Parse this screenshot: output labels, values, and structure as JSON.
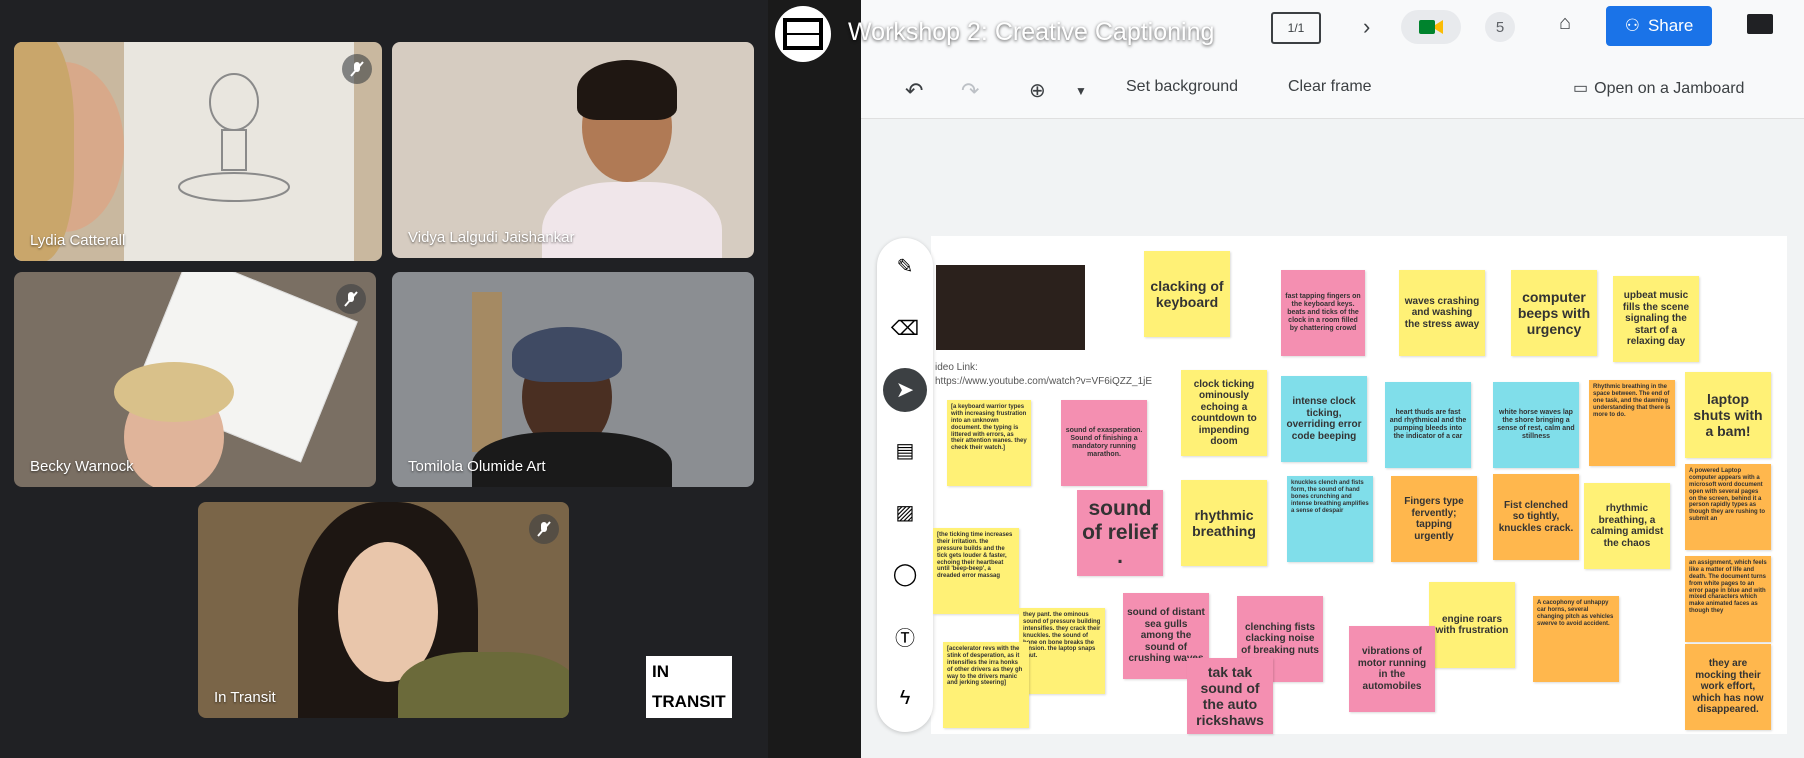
{
  "participants": [
    {
      "name": "Lydia Catterall"
    },
    {
      "name": "Vidya Lalgudi Jaishankar"
    },
    {
      "name": "Becky Warnock"
    },
    {
      "name": "Tomilola Olumide Art"
    },
    {
      "name": "In Transit"
    }
  ],
  "brand_logo": {
    "line1": "IN",
    "line2": "TRANSIT"
  },
  "jamboard": {
    "title": "Workshop 2: Creative Captioning",
    "frame_counter": "1/1",
    "participant_count": "5",
    "share_label": "Share",
    "toolbar": {
      "set_background": "Set background",
      "clear_frame": "Clear frame",
      "open_on_jamboard": "Open on a Jamboard"
    },
    "video_link_label": "ideo Link:",
    "video_link_url": "https://www.youtube.com/watch?v=VF6iQZZ_1jE",
    "notes": [
      {
        "text": "clacking of keyboard"
      },
      {
        "text": "fast tapping fingers on the keyboard keys. beats and ticks of the clock in a room filled by chattering crowd"
      },
      {
        "text": "waves crashing and washing the stress away"
      },
      {
        "text": "computer beeps with urgency"
      },
      {
        "text": "upbeat music fills the scene signaling the start of a relaxing day"
      },
      {
        "text": "[a keyboard warrior types with increasing frustration into an unknown document. the typing is littered with errors, as their attention wanes. they check their watch.]"
      },
      {
        "text": "sound of exasperation. Sound of finishing a mandatory running marathon."
      },
      {
        "text": "clock ticking ominously echoing a countdown to impending doom"
      },
      {
        "text": "intense clock ticking, overriding error code beeping"
      },
      {
        "text": "heart thuds are fast and rhythmical and the pumping bleeds into the indicator of a car"
      },
      {
        "text": "white horse waves lap the shore bringing a sense of rest, calm and stillness"
      },
      {
        "text": "Rhythmic breathing in the space between. The end of one task, and the dawning understanding that there is more to do."
      },
      {
        "text": "laptop shuts with a bam!"
      },
      {
        "text": "sound of relief ."
      },
      {
        "text": "rhythmic breathing"
      },
      {
        "text": "knuckles clench and fists form, the sound of hand bones crunching and intense breathing amplifies a sense of despair"
      },
      {
        "text": "Fingers type fervently; tapping urgently"
      },
      {
        "text": "Fist clenched so tightly, knuckles crack."
      },
      {
        "text": "rhythmic breathing, a calming amidst the chaos"
      },
      {
        "text": "A powered Laptop computer appears with a microsoft word document open with several pages on the screen, behind it a person rapidly types as though they are rushing to submit an"
      },
      {
        "text": "[the ticking time increases their irritation. the pressure builds and the tick gets louder & faster, echoing their heartbeat until 'beep-beep', a dreaded error massag"
      },
      {
        "text": "an assignment, which feels like a matter of life and death. The document turns from white pages to an error page in blue and with mixed characters which make animated faces as though they"
      },
      {
        "text": "sound of distant sea gulls among the sound of crushing waves"
      },
      {
        "text": "clenching fists clacking noise of breaking nuts"
      },
      {
        "text": "engine roars with frustration"
      },
      {
        "text": "A cacophony of unhappy car horns, several changing pitch as vehicles swerve to avoid accident."
      },
      {
        "text": "they pant. the ominous sound of pressure building intensifies. they crack their knuckles. the sound of bone on bone breaks the tension. the laptop snaps shut."
      },
      {
        "text": "[accelerator revs with the stink of desperation, as it intensifies the irra honks of other drivers as they gh way to the drivers manic and jerking steering]"
      },
      {
        "text": "tak tak sound of the auto rickshaws"
      },
      {
        "text": "vibrations of motor running in the automobiles"
      },
      {
        "text": "they are mocking their work effort, which has now disappeared."
      }
    ]
  },
  "colors": {
    "sticky_yellow": "#fff176",
    "sticky_pink": "#f48fb1",
    "sticky_blue": "#80deea",
    "sticky_orange": "#ffb74d",
    "share_blue": "#1a73e8"
  }
}
